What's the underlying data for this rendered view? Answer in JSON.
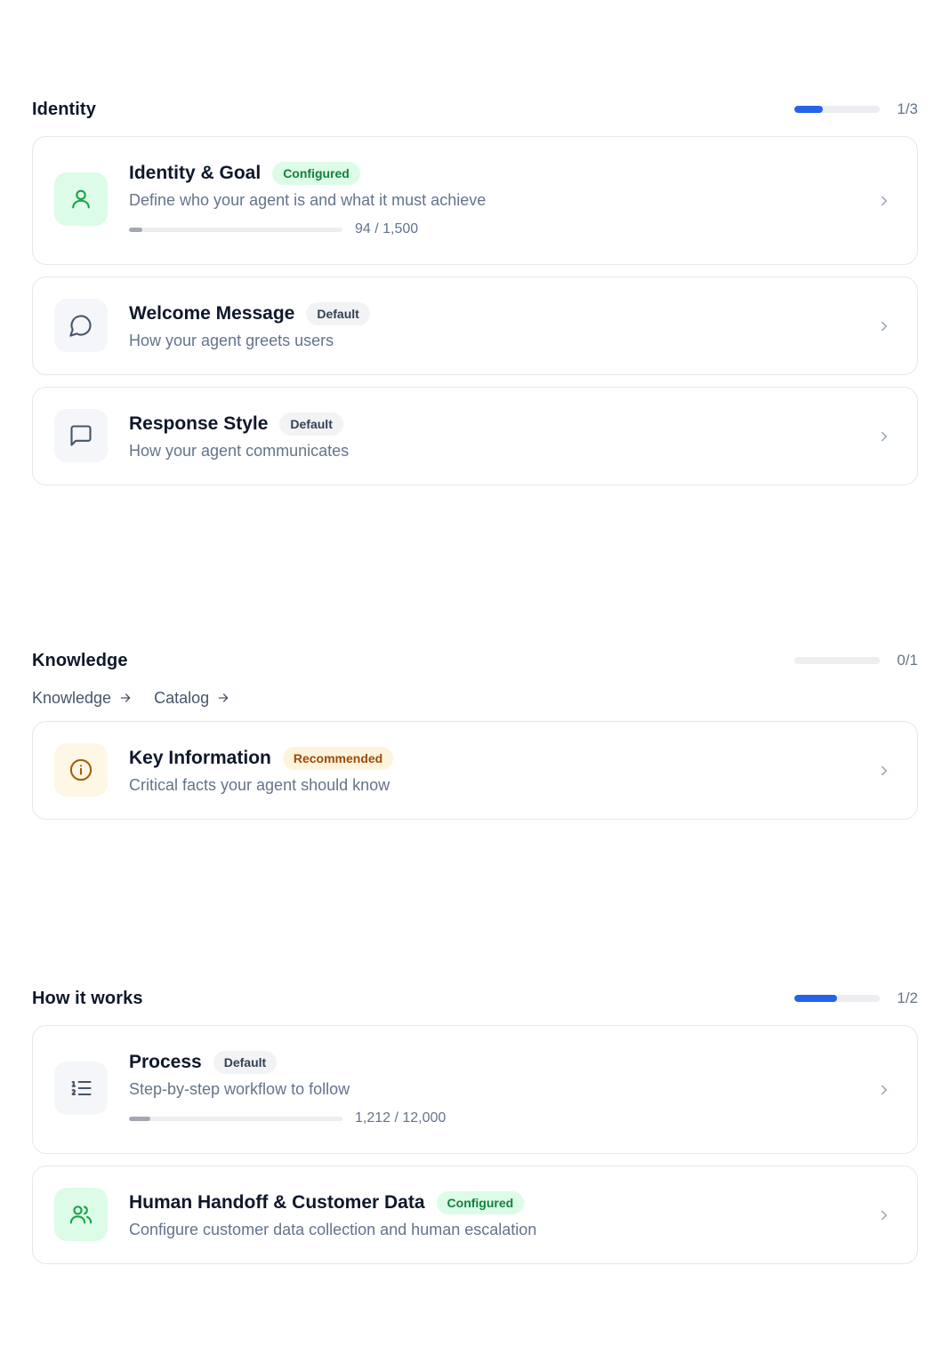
{
  "sections": {
    "identity": {
      "title": "Identity",
      "progress": {
        "count": "1/3",
        "fraction": 0.333
      },
      "cards": [
        {
          "title": "Identity & Goal",
          "badge": "Configured",
          "description": "Define who your agent is and what it must achieve",
          "chars": {
            "label": "94 / 1,500",
            "fraction": 0.063
          },
          "icon": "user-icon"
        },
        {
          "title": "Welcome Message",
          "badge": "Default",
          "description": "How your agent greets users",
          "icon": "chat-bubble-round-icon"
        },
        {
          "title": "Response Style",
          "badge": "Default",
          "description": "How your agent communicates",
          "icon": "chat-bubble-square-icon"
        }
      ]
    },
    "knowledge": {
      "title": "Knowledge",
      "progress": {
        "count": "0/1",
        "fraction": 0
      },
      "links": [
        "Knowledge",
        "Catalog"
      ],
      "cards": [
        {
          "title": "Key Information",
          "badge": "Recommended",
          "description": "Critical facts your agent should know",
          "icon": "info-circle-icon"
        }
      ]
    },
    "how_it_works": {
      "title": "How it works",
      "progress": {
        "count": "1/2",
        "fraction": 0.5
      },
      "cards": [
        {
          "title": "Process",
          "badge": "Default",
          "description": "Step-by-step workflow to follow",
          "chars": {
            "label": "1,212 / 12,000",
            "fraction": 0.101
          },
          "icon": "ordered-list-icon"
        },
        {
          "title": "Human Handoff & Customer Data",
          "badge": "Configured",
          "description": "Configure customer data collection and human escalation",
          "icon": "users-icon"
        }
      ]
    }
  },
  "colors": {
    "accent": "#2563eb",
    "configured": "#15803d",
    "recommended": "#9a4a0b"
  }
}
